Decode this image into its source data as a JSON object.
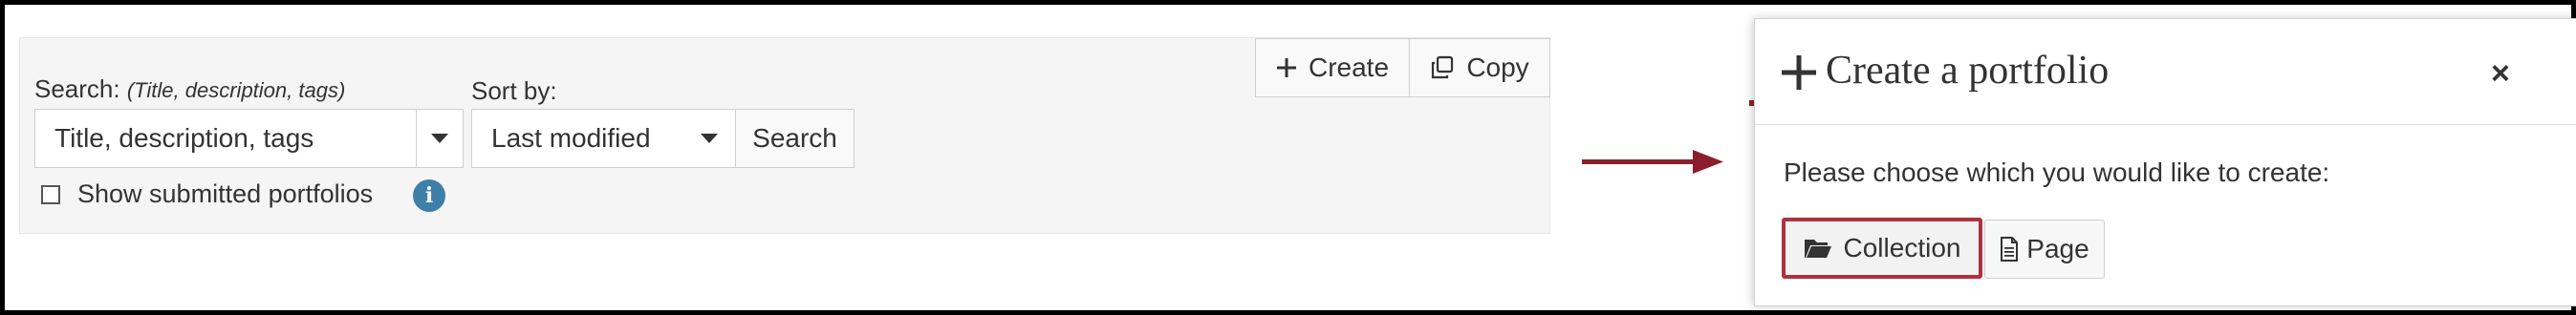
{
  "toolbar": {
    "create_label": "Create",
    "copy_label": "Copy"
  },
  "search": {
    "label": "Search:",
    "hint": "(Title, description, tags)",
    "value": "Title, description, tags",
    "button_label": "Search"
  },
  "sort": {
    "label": "Sort by:",
    "value": "Last modified"
  },
  "filter": {
    "show_submitted_label": "Show submitted portfolios",
    "checked": false
  },
  "modal": {
    "title": "Create a portfolio",
    "prompt": "Please choose which you would like to create:",
    "collection_label": "Collection",
    "page_label": "Page"
  },
  "colors": {
    "accent": "#8b1e2b",
    "info": "#3d7fa8",
    "panel_bg": "#f5f5f5"
  },
  "icons": [
    "plus-icon",
    "copy-icon",
    "chevron-down-icon",
    "info-icon",
    "arrow-right-icon",
    "close-icon",
    "folder-open-icon",
    "page-icon"
  ]
}
